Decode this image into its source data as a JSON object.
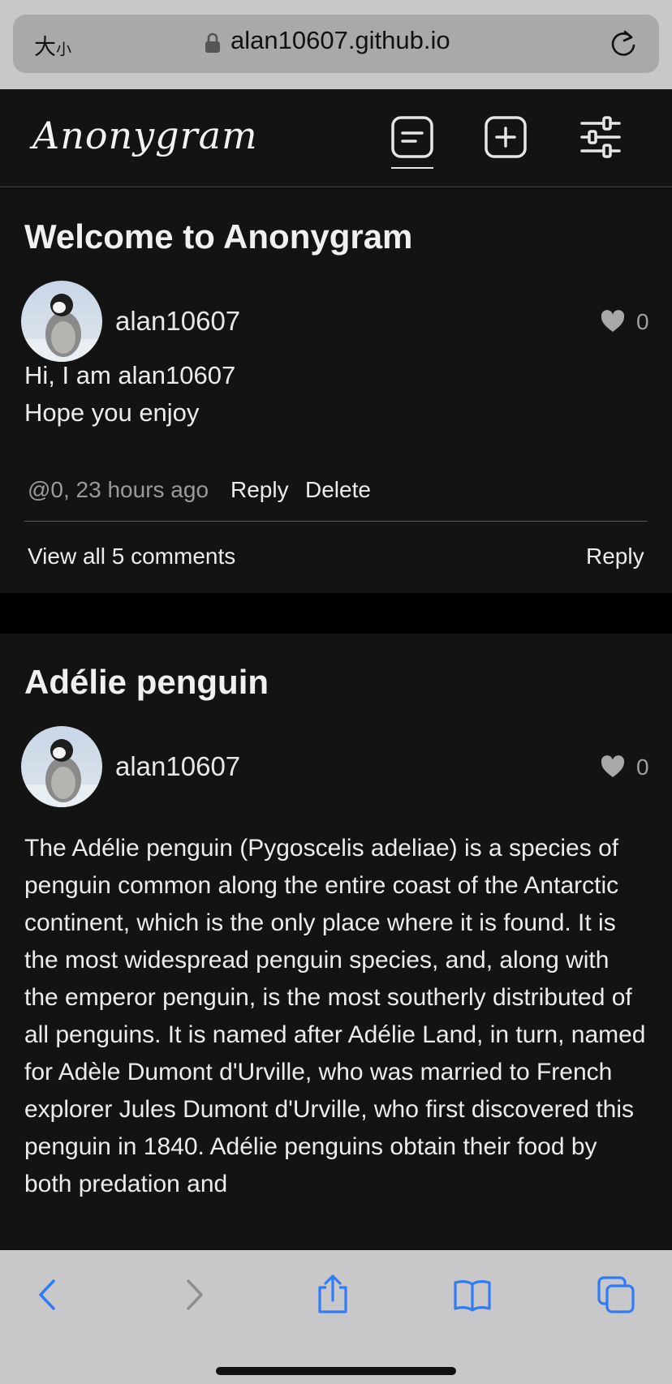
{
  "browser": {
    "text_size_label_large": "大",
    "text_size_label_small": "小",
    "url": "alan10607.github.io",
    "icons": [
      "lock-icon",
      "reload-icon",
      "back-icon",
      "forward-icon",
      "share-icon",
      "bookmarks-icon",
      "tabs-icon"
    ]
  },
  "app": {
    "logo": "Anonygram",
    "nav": [
      {
        "name": "posts-feed",
        "icon": "document-lines-icon",
        "active": true
      },
      {
        "name": "create-post",
        "icon": "plus-square-icon",
        "active": false
      },
      {
        "name": "settings",
        "icon": "sliders-icon",
        "active": false
      }
    ]
  },
  "posts": [
    {
      "title": "Welcome to Anonygram",
      "author": "alan10607",
      "likes": "0",
      "body": "Hi, I am alan10607\nHope you enjoy",
      "meta": "@0, 23 hours ago",
      "reply_label": "Reply",
      "delete_label": "Delete",
      "view_comments": "View all 5 comments",
      "reply_footer": "Reply"
    },
    {
      "title": "Adélie penguin",
      "author": "alan10607",
      "likes": "0",
      "body": "The Adélie penguin (Pygoscelis adeliae) is a species of penguin common along the entire coast of the Antarctic continent, which is the only place where it is found. It is the most widespread penguin species, and, along with the emperor penguin, is the most southerly distributed of all penguins. It is named after Adélie Land, in turn, named for Adèle Dumont d'Urville, who was married to French explorer Jules Dumont d'Urville, who first discovered this penguin in 1840. Adélie penguins obtain their food by both predation and"
    }
  ],
  "colors": {
    "accent_blue": "#2f7cf6",
    "card_bg": "#131313",
    "page_bg": "#000000",
    "safari_bar": "#c8c8ca"
  }
}
